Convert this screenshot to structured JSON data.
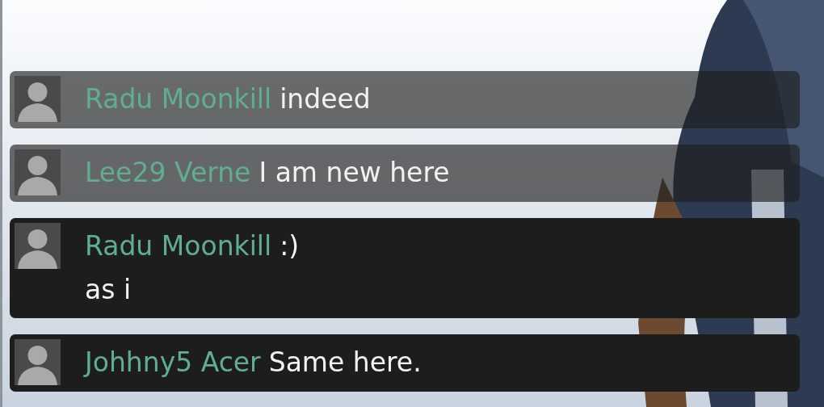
{
  "messages": [
    {
      "name": "Radu Moonkill",
      "lines": [
        "indeed"
      ],
      "faded": true
    },
    {
      "name": "Lee29 Verne",
      "lines": [
        "I am new here"
      ],
      "faded": true
    },
    {
      "name": "Radu Moonkill",
      "lines": [
        ":)",
        "as i"
      ],
      "faded": false
    },
    {
      "name": "Johhny5 Acer",
      "lines": [
        "Same here."
      ],
      "faded": false
    }
  ]
}
